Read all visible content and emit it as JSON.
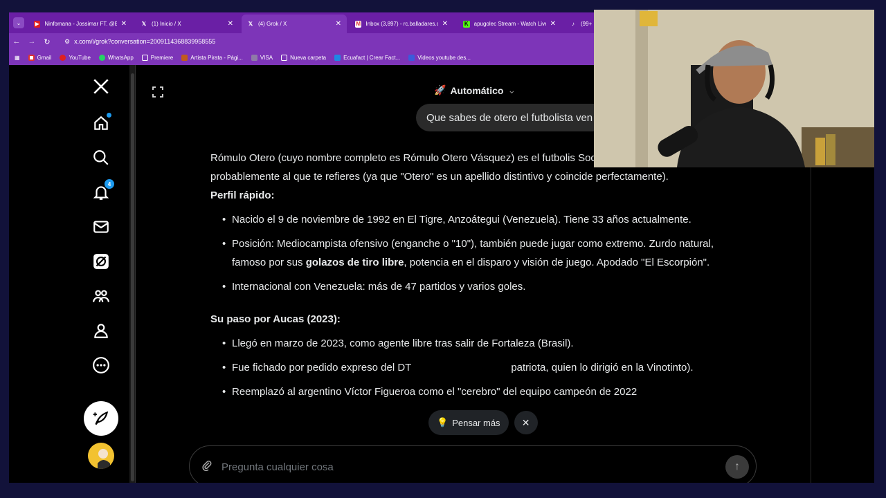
{
  "browser": {
    "tabs": [
      {
        "title": "Ninfomana - Jossimar FT. @El...",
        "icon": "youtube-icon",
        "active": false
      },
      {
        "title": "(1) Inicio / X",
        "icon": "x-icon",
        "active": false
      },
      {
        "title": "(4) Grok / X",
        "icon": "x-icon",
        "active": true
      },
      {
        "title": "Inbox (3,897) - rc.balladares.c...",
        "icon": "gmail-icon",
        "active": false
      },
      {
        "title": "apugolec Stream - Watch Live...",
        "icon": "kick-icon",
        "active": false
      },
      {
        "title": "(99+",
        "icon": "tiktok-icon",
        "active": false
      }
    ],
    "url": "x.com/i/grok?conversation=2009114368839958555",
    "bookmarks": [
      "Gmail",
      "YouTube",
      "WhatsApp",
      "Premiere",
      "Artista Pirata - Pági...",
      "VISA",
      "Nueva carpeta",
      "Ecuafact | Crear Fact...",
      "Videos youtube des..."
    ]
  },
  "sidebar": {
    "notifications_count": "4"
  },
  "grok": {
    "mode": "Automático",
    "user_message": "Que sabes de otero el futbolista ven",
    "response": {
      "intro": "Rómulo Otero (cuyo nombre completo es Rómulo Otero Vásquez) es el futbolis Sociedad Deportiva Aucas, probablemente al que te refieres (ya que \"Otero\" es un apellido distintivo y coincide perfectamente).",
      "section1_title": "Perfil rápido:",
      "section1_items": [
        "Nacido el 9 de noviembre de 1992 en El Tigre, Anzoátegui (Venezuela). Tiene 33 años actualmente.",
        "Internacional con Venezuela: más de 47 partidos y varios goles."
      ],
      "position_item": {
        "before": "Posición: Mediocampista ofensivo (enganche o \"10\"), también puede jugar como extremo. Zurdo natural, famoso por sus ",
        "bold": "golazos de tiro libre",
        "after": ", potencia en el disparo y visión de juego. Apodado \"El Escorpión\"."
      },
      "section2_title": "Su paso por Aucas (2023):",
      "section2_items": [
        "Llegó en marzo de 2023, como agente libre tras salir de Fortaleza (Brasil).",
        "Fue fichado por pedido expreso del DT",
        "patriota, quien lo dirigió en la Vinotinto).",
        "Reemplazó al argentino Víctor Figueroa como el \"cerebro\" del equipo campeón de 2022"
      ]
    },
    "think_more": "Pensar más",
    "input_placeholder": "Pregunta cualquier cosa"
  }
}
